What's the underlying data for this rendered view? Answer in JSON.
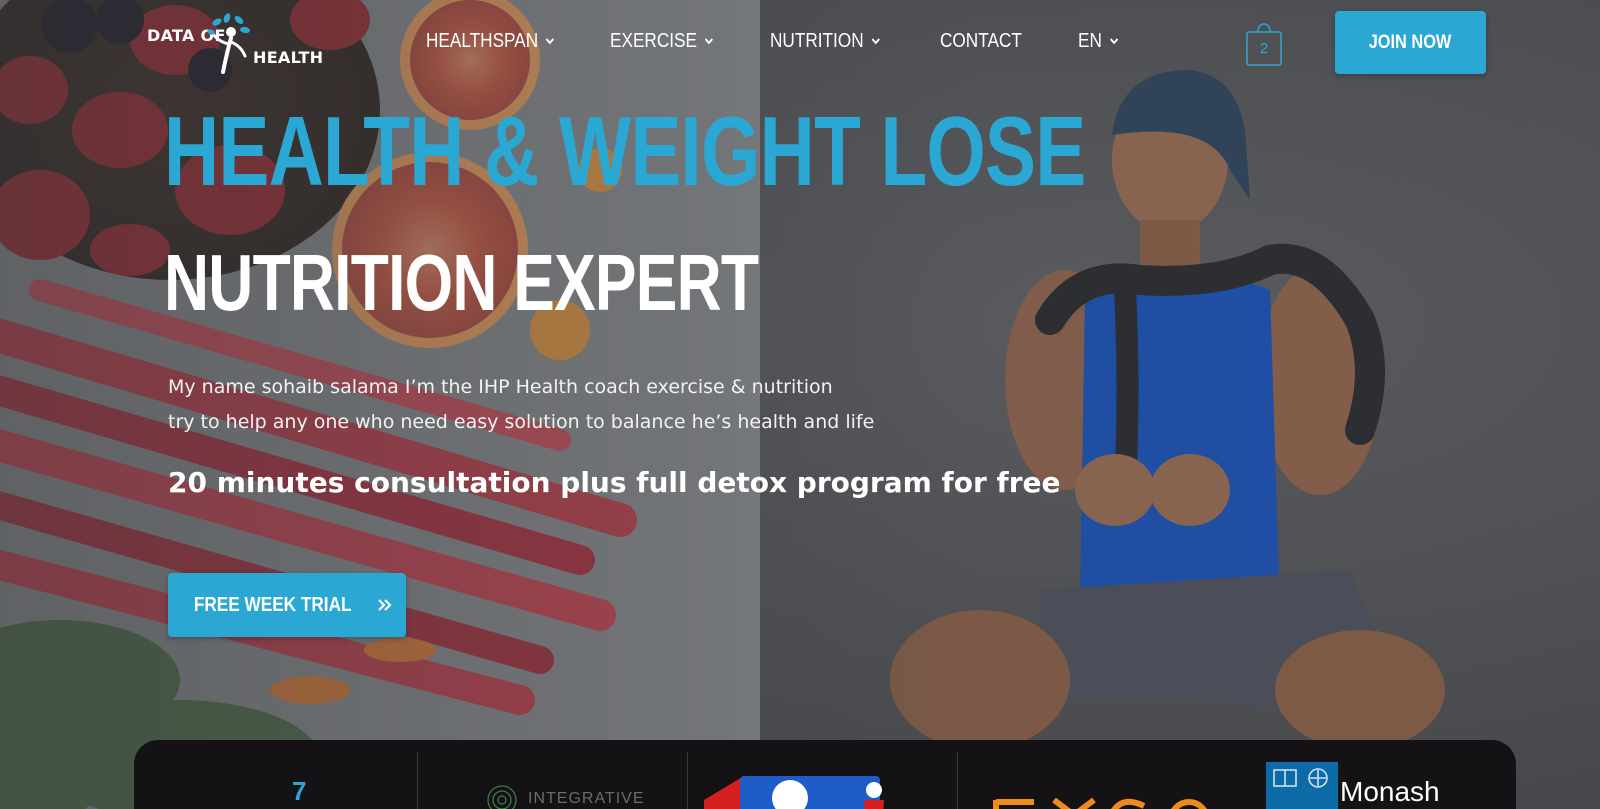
{
  "header": {
    "logo": {
      "line1": "DATA OF",
      "line2": "HEALTH"
    },
    "nav": [
      {
        "label": "HEALTHSPAN",
        "has_dropdown": true
      },
      {
        "label": "EXERCISE",
        "has_dropdown": true
      },
      {
        "label": "NUTRITION",
        "has_dropdown": true
      },
      {
        "label": "CONTACT",
        "has_dropdown": false
      },
      {
        "label": "EN",
        "has_dropdown": true
      }
    ],
    "cart_count": "2",
    "join_label": "JOIN NOW"
  },
  "hero": {
    "title": "HEALTH & WEIGHT LOSE",
    "subtitle": "NUTRITION EXPERT",
    "description_lines": [
      "My name sohaib salama I’m the IHP Health coach exercise & nutrition",
      "try to help any one who need easy solution to balance he’s health and life"
    ],
    "offer": "20 minutes consultation plus full detox program for free",
    "cta_label": "FREE WEEK TRIAL"
  },
  "partners": {
    "items": [
      {
        "name": "partner-logo-1",
        "text": ""
      },
      {
        "name": "partner-logo-integrative",
        "text": "INTEGRATIVE"
      },
      {
        "name": "partner-logo-3",
        "text": ""
      },
      {
        "name": "partner-logo-4",
        "text": ""
      },
      {
        "name": "partner-logo-monash",
        "text": "Monash"
      }
    ]
  },
  "colors": {
    "accent": "#2aa7d3",
    "partner_strip_bg": "#141214",
    "text": "#ffffff"
  },
  "icons": {
    "nav_dropdown": "chevron-down-icon",
    "cart": "shopping-bag-icon",
    "cta": "double-chevron-right-icon"
  }
}
